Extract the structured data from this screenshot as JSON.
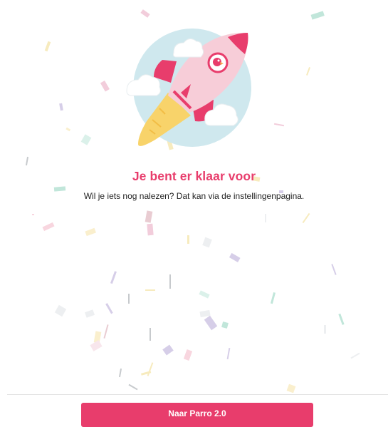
{
  "headline": "Je bent er klaar voor",
  "subtext": "Wil je iets nog nalezen? Dat kan via de instellingenpagina.",
  "primary_button": "Naar Parro 2.0",
  "illustration": {
    "icon": "rocket-icon",
    "logo": "parro-logo-icon"
  },
  "colors": {
    "brand": "#e83d6c",
    "sky": "#cfe8ee",
    "rocket_body": "#f7cdd8",
    "flame": "#f8d36a"
  }
}
